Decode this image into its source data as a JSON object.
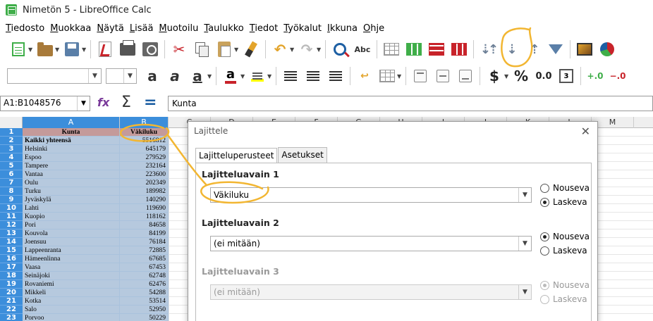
{
  "window": {
    "title": "Nimetön 5 - LibreOffice Calc"
  },
  "menu": [
    {
      "u": "T",
      "rest": "iedosto"
    },
    {
      "u": "M",
      "rest": "uokkaa"
    },
    {
      "u": "N",
      "rest": "äytä"
    },
    {
      "u": "L",
      "rest": "isää"
    },
    {
      "u": "M",
      "rest": "uotoilu"
    },
    {
      "u": "T",
      "rest": "aulukko"
    },
    {
      "u": "T",
      "rest": "iedot"
    },
    {
      "u": "T",
      "rest": "yökalut"
    },
    {
      "u": "I",
      "rest": "kkuna"
    },
    {
      "u": "O",
      "rest": "hje"
    }
  ],
  "toolbar2": {
    "font_name": "",
    "font_size": "",
    "currency_symbol": "$",
    "percent_symbol": "%",
    "decimal_label": "0.0",
    "date_label": "3"
  },
  "formula_bar": {
    "name_box": "A1:B1048576",
    "content": "Kunta"
  },
  "columns": [
    "A",
    "B",
    "C",
    "D",
    "E",
    "F",
    "G",
    "H",
    "I",
    "J",
    "K",
    "L",
    "M"
  ],
  "rows": [
    {
      "n": "1",
      "a": "Kunta",
      "b": "Väkiluku"
    },
    {
      "n": "2",
      "a": "Kaikki yhteensä",
      "b": "5516812"
    },
    {
      "n": "3",
      "a": "Helsinki",
      "b": "645179"
    },
    {
      "n": "4",
      "a": "Espoo",
      "b": "279529"
    },
    {
      "n": "5",
      "a": "Tampere",
      "b": "232164"
    },
    {
      "n": "6",
      "a": "Vantaa",
      "b": "223600"
    },
    {
      "n": "7",
      "a": "Oulu",
      "b": "202349"
    },
    {
      "n": "8",
      "a": "Turku",
      "b": "189982"
    },
    {
      "n": "9",
      "a": "Jyväskylä",
      "b": "140290"
    },
    {
      "n": "10",
      "a": "Lahti",
      "b": "119690"
    },
    {
      "n": "11",
      "a": "Kuopio",
      "b": "118162"
    },
    {
      "n": "12",
      "a": "Pori",
      "b": "84658"
    },
    {
      "n": "13",
      "a": "Kouvola",
      "b": "84199"
    },
    {
      "n": "14",
      "a": "Joensuu",
      "b": "76184"
    },
    {
      "n": "15",
      "a": "Lappeenranta",
      "b": "72885"
    },
    {
      "n": "16",
      "a": "Hämeenlinna",
      "b": "67685"
    },
    {
      "n": "17",
      "a": "Vaasa",
      "b": "67453"
    },
    {
      "n": "18",
      "a": "Seinäjoki",
      "b": "62748"
    },
    {
      "n": "19",
      "a": "Rovaniemi",
      "b": "62476"
    },
    {
      "n": "20",
      "a": "Mikkeli",
      "b": "54288"
    },
    {
      "n": "21",
      "a": "Kotka",
      "b": "53514"
    },
    {
      "n": "22",
      "a": "Salo",
      "b": "52950"
    },
    {
      "n": "23",
      "a": "Porvoo",
      "b": "50229"
    }
  ],
  "dialog": {
    "title": "Lajittele",
    "tabs": [
      "Lajitteluperusteet",
      "Asetukset"
    ],
    "key1": {
      "label": "Lajitteluavain 1",
      "value": "Väkiluku",
      "asc": "Nouseva",
      "desc": "Laskeva",
      "selected": "desc"
    },
    "key2": {
      "label": "Lajitteluavain 2",
      "value": "(ei mitään)",
      "asc": "Nouseva",
      "desc": "Laskeva",
      "selected": "asc"
    },
    "key3": {
      "label": "Lajitteluavain 3",
      "value": "(ei mitään)",
      "asc": "Nouseva",
      "desc": "Laskeva",
      "selected": "asc"
    }
  },
  "colors": {
    "selection": "#3c8edb",
    "cell_selected": "#b6c9de",
    "header_cell": "#c49a9a",
    "annotation": "#f2b632"
  }
}
